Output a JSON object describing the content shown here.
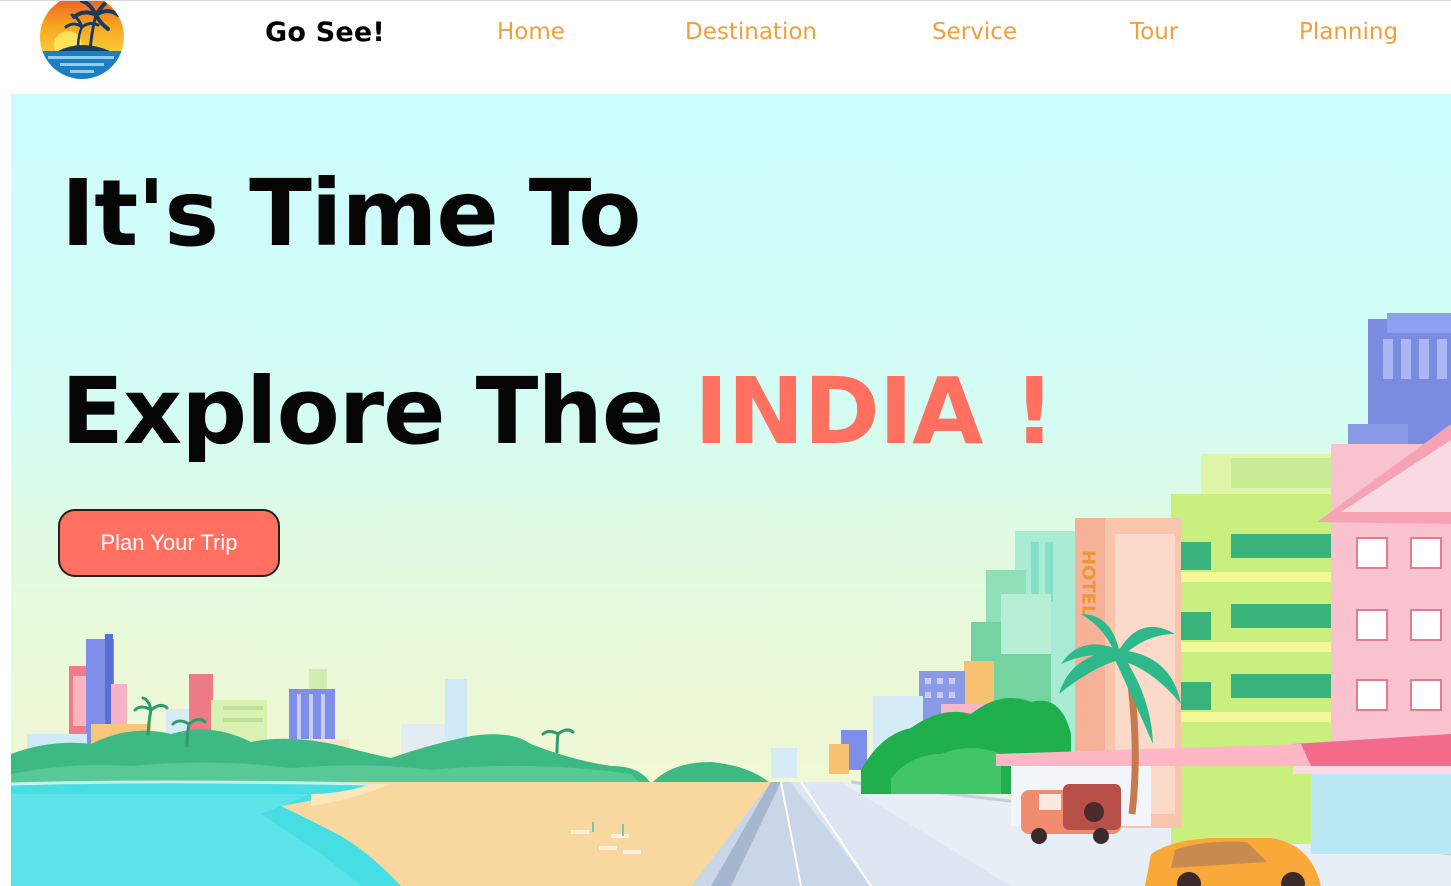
{
  "brand": {
    "name": "Go See!"
  },
  "nav": {
    "home": "Home",
    "destination": "Destination",
    "service": "Service",
    "tour": "Tour",
    "planning": "Planning"
  },
  "hero": {
    "line1": "It's Time To",
    "line2_prefix": "Explore The ",
    "line2_accent": "INDIA !",
    "cta_label": "Plan Your Trip",
    "hotel_sign": "HOTEL"
  },
  "colors": {
    "accent": "#ff7060",
    "nav_link": "#f0a03a",
    "sky_top": "#ccfdfc"
  },
  "icons": {
    "logo": "sunset-palm-island-logo"
  }
}
